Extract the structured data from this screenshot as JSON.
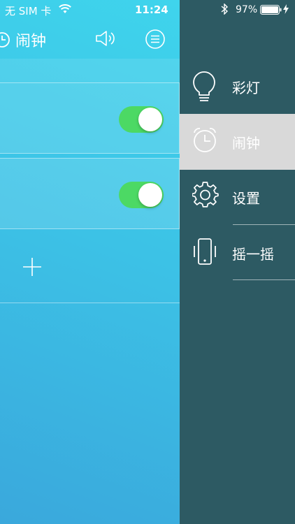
{
  "status_bar": {
    "carrier": "无 SIM 卡",
    "time": "11:24",
    "battery": "97%"
  },
  "navbar": {
    "title": "闹钟",
    "icons": [
      "alarm-clock-icon",
      "speaker-icon",
      "menu-icon"
    ]
  },
  "alarms": [
    {
      "enabled": true
    },
    {
      "enabled": true
    }
  ],
  "add_button_icon": "plus-icon",
  "side_menu": {
    "items": [
      {
        "label": "彩灯",
        "icon": "lightbulb-icon",
        "active": false
      },
      {
        "label": "闹钟",
        "icon": "alarm-clock-icon",
        "active": true
      },
      {
        "label": "设置",
        "icon": "gear-icon",
        "active": false
      },
      {
        "label": "摇一摇",
        "icon": "phone-shake-icon",
        "active": false
      }
    ]
  },
  "colors": {
    "main_gradient_top": "#3fd4ec",
    "main_gradient_bottom": "#3aa8dc",
    "side_bg": "#2d5a63",
    "active_item_bg": "#d9d9d9",
    "toggle_on": "#4cd964"
  }
}
